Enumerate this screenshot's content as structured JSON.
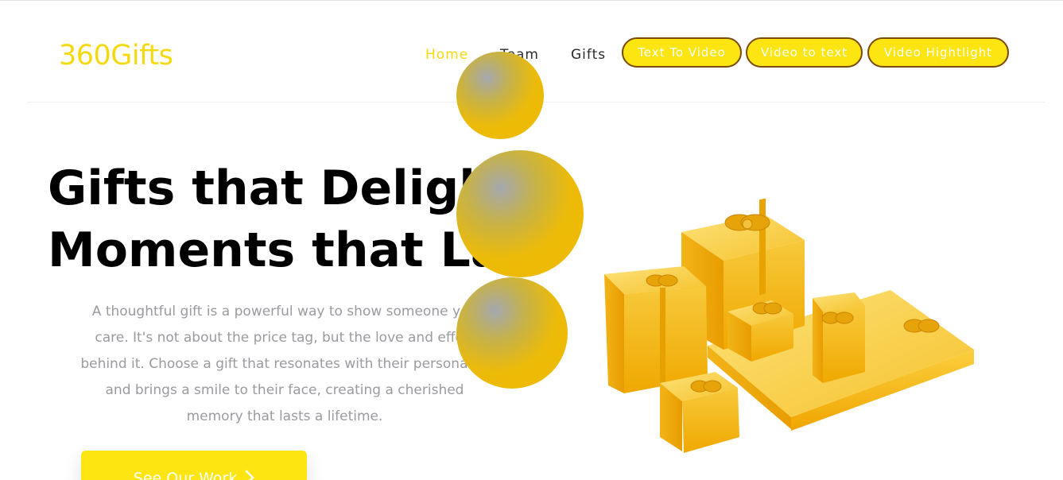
{
  "header": {
    "logo": "360Gifts",
    "nav": [
      {
        "label": "Home",
        "active": true
      },
      {
        "label": "Team",
        "active": false
      },
      {
        "label": "Gifts",
        "active": false
      }
    ],
    "pills": [
      "Text To Video",
      "Video to text",
      "Video Hightlight"
    ]
  },
  "hero": {
    "title_line1": "Gifts that Delight,",
    "title_line2": "Moments that Last",
    "description": "A thoughtful gift is a powerful way to show someone you care. It's not about the price tag, but the love and effort behind it. Choose a gift that resonates with their personality and brings a smile to their face, creating a cherished memory that lasts a lifetime.",
    "cta_label": "See Our Work",
    "cta_icon": "chevron-right-icon"
  },
  "colors": {
    "brand_yellow": "#fde512",
    "pill_border": "#7a4a0c",
    "loader_gold": "#efbb00"
  }
}
